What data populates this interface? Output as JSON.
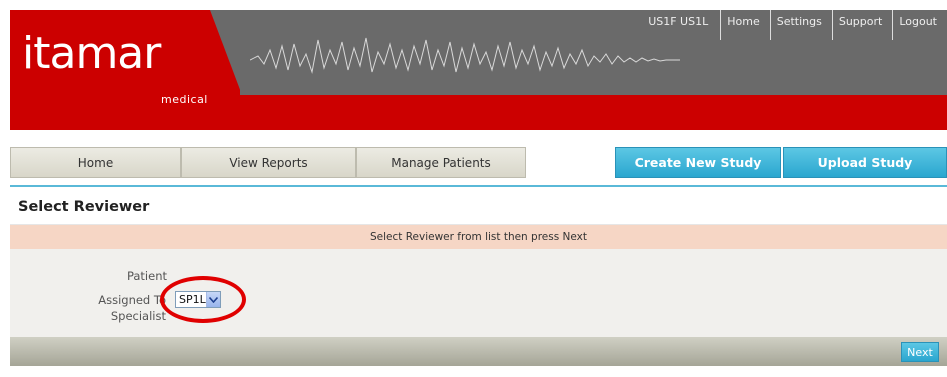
{
  "header": {
    "logo_text": "itamar",
    "logo_subtext": "medical",
    "user": "US1F US1L",
    "top_links": [
      "Home",
      "Settings",
      "Support",
      "Logout"
    ]
  },
  "nav": {
    "tabs": [
      "Home",
      "View Reports",
      "Manage Patients"
    ],
    "actions": [
      "Create New Study",
      "Upload Study"
    ]
  },
  "page": {
    "title": "Select Reviewer",
    "instruction": "Select Reviewer from list then press Next"
  },
  "form": {
    "patient_label": "Patient",
    "assigned_label_line1": "Assigned To",
    "assigned_label_line2": "Specialist",
    "reviewer_value": "SP1L"
  },
  "footer": {
    "next_label": "Next"
  },
  "colors": {
    "brand_red": "#cc0000",
    "accent_blue": "#2aa6cf",
    "instruction_bg": "#f6d6c5",
    "highlight_circle": "#e00000"
  },
  "icons": [
    "waveform-graphic",
    "chevron-down-icon"
  ]
}
